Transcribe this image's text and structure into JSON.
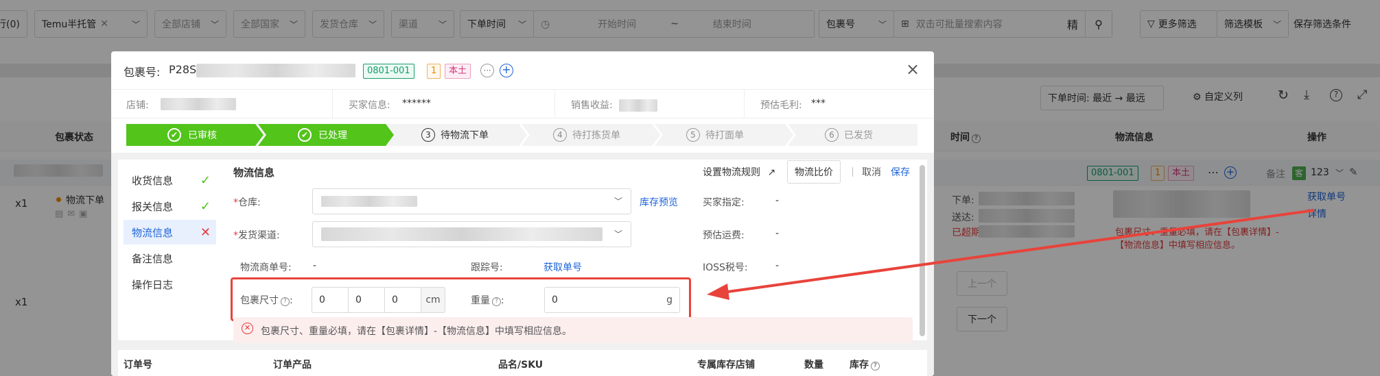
{
  "filters": {
    "tab_left": "行(0)",
    "platform": "Temu半托管",
    "store": "全部店铺",
    "country": "全部国家",
    "warehouse": "发货仓库",
    "channel": "渠道",
    "time_type": "下单时间",
    "start_placeholder": "开始时间",
    "tilde": "~",
    "end_placeholder": "结束时间",
    "search_type": "包裹号",
    "search_placeholder": "双击可批量搜索内容",
    "exact": "精",
    "more_filters": "更多筛选",
    "filter_template": "筛选模板",
    "save_filter": "保存筛选条件"
  },
  "toolbar": {
    "sort_label": "下单时间:",
    "sort_value": "最近 → 最远",
    "custom_columns": "自定义列"
  },
  "table_header": {
    "status": "包裹状态",
    "time": "时间",
    "logistics": "物流信息",
    "actions": "操作"
  },
  "bg_row": {
    "tag_code": "0801-001",
    "tag_count": "1",
    "tag_local": "本土",
    "note_label": "备注",
    "cust_badge": "客",
    "cust_num": "123",
    "qty1": "x1",
    "qty2": "x1",
    "status": "物流下单",
    "order_label": "下单:",
    "deliver_label": "送达:",
    "overdue": "已超期",
    "error_text": "包裹尺寸、重量必填，请在【包裹详情】-【物流信息】中填写相应信息。",
    "get_tracking": "获取单号",
    "details": "详情",
    "prev": "上一个",
    "next": "下一个"
  },
  "modal": {
    "package_label": "包裹号:",
    "package_no": "P28S",
    "tag_code": "0801-001",
    "tag_count": "1",
    "tag_local": "本土",
    "close": "×",
    "info": {
      "store_label": "店铺:",
      "buyer_label": "买家信息:",
      "buyer_value": "******",
      "revenue_label": "销售收益:",
      "profit_label": "预估毛利:",
      "profit_value": "***"
    },
    "steps": [
      {
        "num": "1",
        "label": "已审核"
      },
      {
        "num": "2",
        "label": "已处理"
      },
      {
        "num": "3",
        "label": "待物流下单"
      },
      {
        "num": "4",
        "label": "待打拣货单"
      },
      {
        "num": "5",
        "label": "待打面单"
      },
      {
        "num": "6",
        "label": "已发货"
      }
    ],
    "nav": [
      {
        "label": "收货信息",
        "state": "ok"
      },
      {
        "label": "报关信息",
        "state": "ok"
      },
      {
        "label": "物流信息",
        "state": "error"
      },
      {
        "label": "备注信息",
        "state": ""
      },
      {
        "label": "操作日志",
        "state": ""
      }
    ],
    "section_title": "物流信息",
    "set_rule": "设置物流规则",
    "compare": "物流比价",
    "cancel": "取消",
    "save": "保存",
    "warehouse_label": "仓库:",
    "stock_preview": "库存预览",
    "channel_label": "发货渠道:",
    "buyer_assigned_label": "买家指定:",
    "buyer_assigned_value": "-",
    "est_freight_label": "预估运费:",
    "est_freight_value": "-",
    "carrier_no_label": "物流商单号:",
    "carrier_no_value": "-",
    "tracking_label": "跟踪号:",
    "get_tracking": "获取单号",
    "ioss_label": "IOSS税号:",
    "ioss_value": "-",
    "size_label": "包裹尺寸",
    "size_l": "0",
    "size_w": "0",
    "size_h": "0",
    "size_unit": "cm",
    "weight_label": "重量",
    "weight_value": "0",
    "weight_unit": "g",
    "error_msg": "包裹尺寸、重量必填，请在【包裹详情】-【物流信息】中填写相应信息。",
    "table_headers": {
      "order_no": "订单号",
      "product": "订单产品",
      "sku": "品名/SKU",
      "store": "专属库存店铺",
      "qty": "数量",
      "stock": "库存"
    }
  },
  "colors": {
    "step_done": "#52c41a",
    "link": "#1e64d8",
    "error": "#e4393c",
    "annotation": "#e8433a"
  }
}
